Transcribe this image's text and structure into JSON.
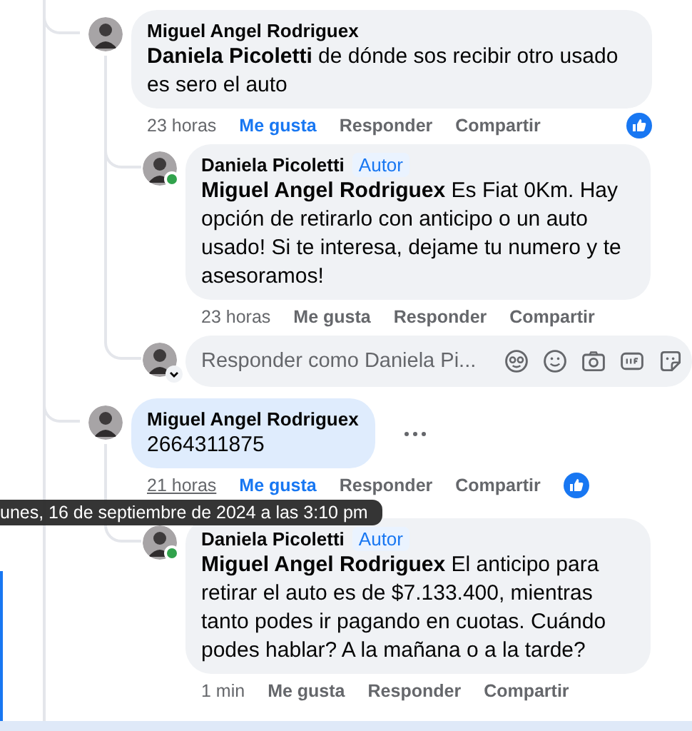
{
  "comments": [
    {
      "author": "Miguel Angel Rodriguex",
      "online": false,
      "highlighted": false,
      "menu_visible": false,
      "body": "**Daniela Picoletti** de dónde sos recibir otro usado es sero el auto",
      "time": "23 horas",
      "time_hovered": false,
      "like_label": "Me gusta",
      "liked": true,
      "reply_label": "Responder",
      "share_label": "Compartir",
      "reaction": true,
      "replies": [
        {
          "author": "Daniela Picoletti",
          "badge": "Autor",
          "online": true,
          "highlighted": false,
          "menu_visible": false,
          "body": "**Miguel Angel Rodriguex** Es Fiat 0Km. Hay opción de retirarlo con anticipo o un auto usado! Si te interesa, dejame tu numero y te asesoramos!",
          "time": "23 horas",
          "time_hovered": false,
          "like_label": "Me gusta",
          "liked": false,
          "reply_label": "Responder",
          "share_label": "Compartir",
          "reaction": false
        }
      ],
      "reply_box": {
        "placeholder": "Responder como Daniela Pi..."
      }
    },
    {
      "author": "Miguel Angel Rodriguex",
      "online": false,
      "highlighted": true,
      "menu_visible": true,
      "body": "2664311875",
      "time": "21 horas",
      "time_hovered": true,
      "like_label": "Me gusta",
      "liked": true,
      "reply_label": "Responder",
      "share_label": "Compartir",
      "reaction": true,
      "replies": [
        {
          "author": "Daniela Picoletti",
          "badge": "Autor",
          "online": true,
          "highlighted": false,
          "menu_visible": false,
          "body": "**Miguel Angel Rodriguex** El anticipo para retirar el auto es de $7.133.400, mientras tanto podes ir pagando en cuotas. Cuándo podes hablar? A la mañana o a la tarde?",
          "time": "1 min",
          "time_hovered": false,
          "like_label": "Me gusta",
          "liked": false,
          "reply_label": "Responder",
          "share_label": "Compartir",
          "reaction": false
        }
      ]
    }
  ],
  "tooltip": {
    "text": "unes, 16 de septiembre de 2024 a las 3:10 pm"
  }
}
